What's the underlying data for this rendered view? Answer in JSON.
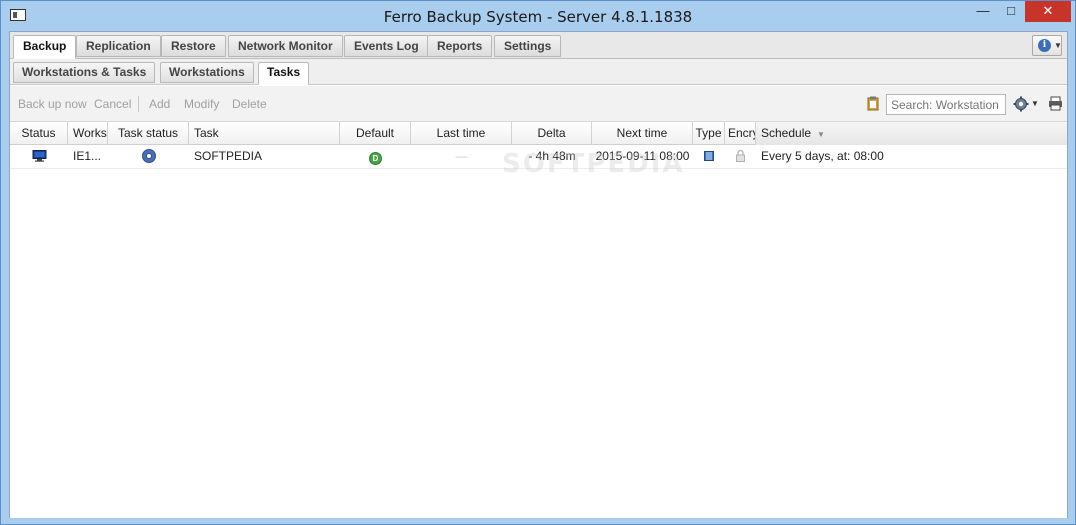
{
  "window": {
    "title": "Ferro Backup System - Server 4.8.1.1838",
    "min_glyph": "—",
    "max_glyph": "□",
    "close_glyph": "✕"
  },
  "main_tabs": [
    {
      "label": "Backup",
      "active": true
    },
    {
      "label": "Replication",
      "active": false
    },
    {
      "label": "Restore",
      "active": false
    },
    {
      "label": "Network Monitor",
      "active": false
    },
    {
      "label": "Events Log",
      "active": false
    },
    {
      "label": "Reports",
      "active": false
    },
    {
      "label": "Settings",
      "active": false
    }
  ],
  "sub_tabs": [
    {
      "label": "Workstations & Tasks",
      "active": false
    },
    {
      "label": "Workstations",
      "active": false
    },
    {
      "label": "Tasks",
      "active": true
    }
  ],
  "toolbar": {
    "backup_now": "Back up now",
    "cancel": "Cancel",
    "add": "Add",
    "modify": "Modify",
    "delete": "Delete",
    "search_placeholder": "Search: Workstation"
  },
  "grid": {
    "columns": [
      "Status",
      "Workst",
      "Task status",
      "Task",
      "Default",
      "Last time",
      "Delta",
      "Next time",
      "Type",
      "Encry",
      "Schedule"
    ],
    "rows": [
      {
        "workstation": "IE1...",
        "task": "SOFTPEDIA",
        "default_glyph": "D",
        "last_time": "—",
        "delta": "- 4h 48m",
        "next_time": "2015-09-11 08:00",
        "schedule": "Every 5 days, at: 08:00"
      }
    ]
  },
  "watermark": "SOFTPEDIA",
  "icons": {
    "app": "app-window-icon",
    "info": "info-icon",
    "clipboard": "clipboard-icon",
    "gear": "gear-icon",
    "print": "print-icon",
    "status": "monitor-icon",
    "task_status": "task-status-icon",
    "type": "type-icon",
    "encryption": "lock-icon"
  },
  "colors": {
    "titlebar": "#a9cdef",
    "close": "#c7352a",
    "default_green": "#4aa34a",
    "task_blue": "#4b6fb3"
  }
}
